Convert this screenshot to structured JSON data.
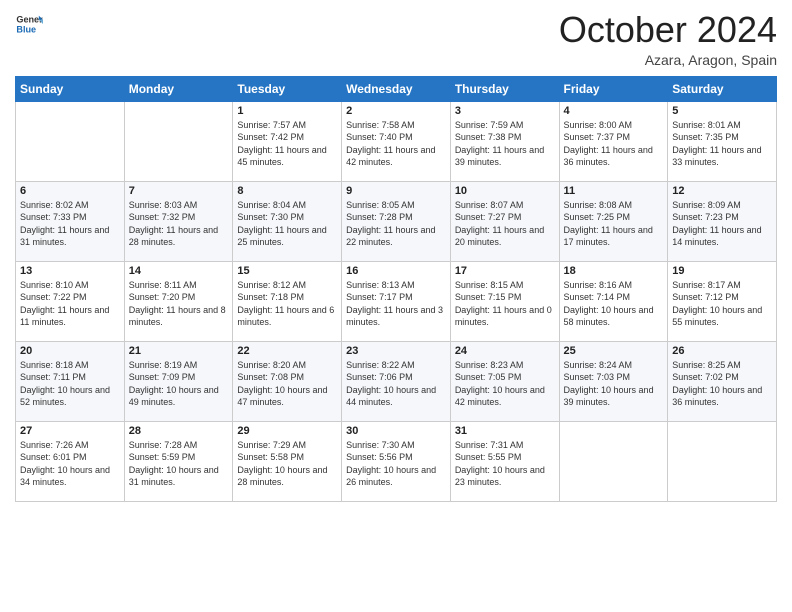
{
  "logo": {
    "line1": "General",
    "line2": "Blue"
  },
  "title": "October 2024",
  "location": "Azara, Aragon, Spain",
  "days_of_week": [
    "Sunday",
    "Monday",
    "Tuesday",
    "Wednesday",
    "Thursday",
    "Friday",
    "Saturday"
  ],
  "weeks": [
    [
      {
        "day": "",
        "info": ""
      },
      {
        "day": "",
        "info": ""
      },
      {
        "day": "1",
        "info": "Sunrise: 7:57 AM\nSunset: 7:42 PM\nDaylight: 11 hours and 45 minutes."
      },
      {
        "day": "2",
        "info": "Sunrise: 7:58 AM\nSunset: 7:40 PM\nDaylight: 11 hours and 42 minutes."
      },
      {
        "day": "3",
        "info": "Sunrise: 7:59 AM\nSunset: 7:38 PM\nDaylight: 11 hours and 39 minutes."
      },
      {
        "day": "4",
        "info": "Sunrise: 8:00 AM\nSunset: 7:37 PM\nDaylight: 11 hours and 36 minutes."
      },
      {
        "day": "5",
        "info": "Sunrise: 8:01 AM\nSunset: 7:35 PM\nDaylight: 11 hours and 33 minutes."
      }
    ],
    [
      {
        "day": "6",
        "info": "Sunrise: 8:02 AM\nSunset: 7:33 PM\nDaylight: 11 hours and 31 minutes."
      },
      {
        "day": "7",
        "info": "Sunrise: 8:03 AM\nSunset: 7:32 PM\nDaylight: 11 hours and 28 minutes."
      },
      {
        "day": "8",
        "info": "Sunrise: 8:04 AM\nSunset: 7:30 PM\nDaylight: 11 hours and 25 minutes."
      },
      {
        "day": "9",
        "info": "Sunrise: 8:05 AM\nSunset: 7:28 PM\nDaylight: 11 hours and 22 minutes."
      },
      {
        "day": "10",
        "info": "Sunrise: 8:07 AM\nSunset: 7:27 PM\nDaylight: 11 hours and 20 minutes."
      },
      {
        "day": "11",
        "info": "Sunrise: 8:08 AM\nSunset: 7:25 PM\nDaylight: 11 hours and 17 minutes."
      },
      {
        "day": "12",
        "info": "Sunrise: 8:09 AM\nSunset: 7:23 PM\nDaylight: 11 hours and 14 minutes."
      }
    ],
    [
      {
        "day": "13",
        "info": "Sunrise: 8:10 AM\nSunset: 7:22 PM\nDaylight: 11 hours and 11 minutes."
      },
      {
        "day": "14",
        "info": "Sunrise: 8:11 AM\nSunset: 7:20 PM\nDaylight: 11 hours and 8 minutes."
      },
      {
        "day": "15",
        "info": "Sunrise: 8:12 AM\nSunset: 7:18 PM\nDaylight: 11 hours and 6 minutes."
      },
      {
        "day": "16",
        "info": "Sunrise: 8:13 AM\nSunset: 7:17 PM\nDaylight: 11 hours and 3 minutes."
      },
      {
        "day": "17",
        "info": "Sunrise: 8:15 AM\nSunset: 7:15 PM\nDaylight: 11 hours and 0 minutes."
      },
      {
        "day": "18",
        "info": "Sunrise: 8:16 AM\nSunset: 7:14 PM\nDaylight: 10 hours and 58 minutes."
      },
      {
        "day": "19",
        "info": "Sunrise: 8:17 AM\nSunset: 7:12 PM\nDaylight: 10 hours and 55 minutes."
      }
    ],
    [
      {
        "day": "20",
        "info": "Sunrise: 8:18 AM\nSunset: 7:11 PM\nDaylight: 10 hours and 52 minutes."
      },
      {
        "day": "21",
        "info": "Sunrise: 8:19 AM\nSunset: 7:09 PM\nDaylight: 10 hours and 49 minutes."
      },
      {
        "day": "22",
        "info": "Sunrise: 8:20 AM\nSunset: 7:08 PM\nDaylight: 10 hours and 47 minutes."
      },
      {
        "day": "23",
        "info": "Sunrise: 8:22 AM\nSunset: 7:06 PM\nDaylight: 10 hours and 44 minutes."
      },
      {
        "day": "24",
        "info": "Sunrise: 8:23 AM\nSunset: 7:05 PM\nDaylight: 10 hours and 42 minutes."
      },
      {
        "day": "25",
        "info": "Sunrise: 8:24 AM\nSunset: 7:03 PM\nDaylight: 10 hours and 39 minutes."
      },
      {
        "day": "26",
        "info": "Sunrise: 8:25 AM\nSunset: 7:02 PM\nDaylight: 10 hours and 36 minutes."
      }
    ],
    [
      {
        "day": "27",
        "info": "Sunrise: 7:26 AM\nSunset: 6:01 PM\nDaylight: 10 hours and 34 minutes."
      },
      {
        "day": "28",
        "info": "Sunrise: 7:28 AM\nSunset: 5:59 PM\nDaylight: 10 hours and 31 minutes."
      },
      {
        "day": "29",
        "info": "Sunrise: 7:29 AM\nSunset: 5:58 PM\nDaylight: 10 hours and 28 minutes."
      },
      {
        "day": "30",
        "info": "Sunrise: 7:30 AM\nSunset: 5:56 PM\nDaylight: 10 hours and 26 minutes."
      },
      {
        "day": "31",
        "info": "Sunrise: 7:31 AM\nSunset: 5:55 PM\nDaylight: 10 hours and 23 minutes."
      },
      {
        "day": "",
        "info": ""
      },
      {
        "day": "",
        "info": ""
      }
    ]
  ]
}
